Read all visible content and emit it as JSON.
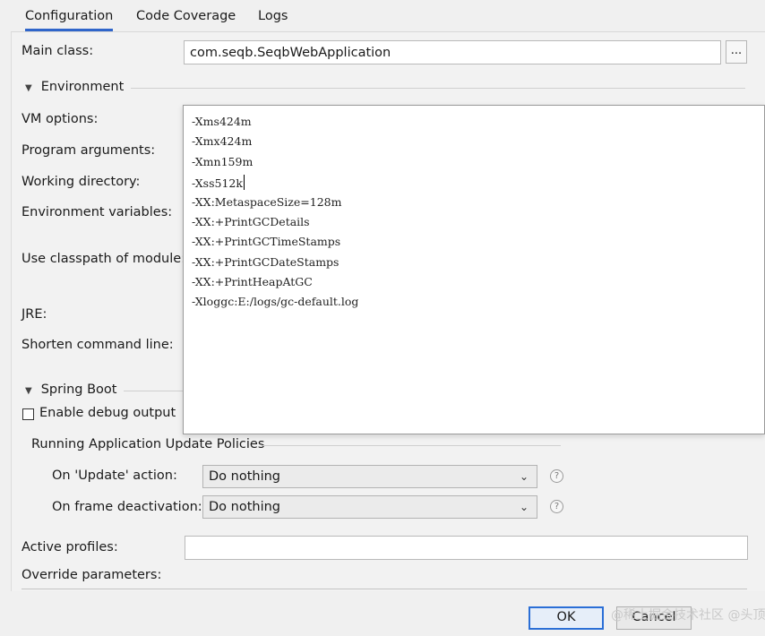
{
  "tabs": [
    {
      "label": "Configuration",
      "active": true
    },
    {
      "label": "Code Coverage",
      "active": false
    },
    {
      "label": "Logs",
      "active": false
    }
  ],
  "main_class": {
    "label": "Main class:",
    "value": "com.seqb.SeqbWebApplication",
    "browse": "..."
  },
  "environment": {
    "section_title": "Environment",
    "labels": {
      "vm_options": "VM options:",
      "program_arguments": "Program arguments:",
      "working_directory": "Working directory:",
      "environment_variables": "Environment variables:",
      "use_classpath": "Use classpath of module:",
      "jre": "JRE:",
      "shorten_command_line": "Shorten command line:"
    }
  },
  "vm_options_lines": [
    "-Xms424m",
    "-Xmx424m",
    "-Xmn159m",
    "-Xss512k",
    "-XX:MetaspaceSize=128m",
    "-XX:+PrintGCDetails",
    "-XX:+PrintGCTimeStamps",
    "-XX:+PrintGCDateStamps",
    "-XX:+PrintHeapAtGC",
    "-Xloggc:E:/logs/gc-default.log"
  ],
  "spring_boot": {
    "section_title": "Spring Boot",
    "enable_debug_output": {
      "label": "Enable debug output",
      "checked": false
    },
    "update_policies": {
      "title": "Running Application Update Policies",
      "on_update": {
        "label": "On 'Update' action:",
        "value": "Do nothing"
      },
      "on_frame_deactivation": {
        "label": "On frame deactivation:",
        "value": "Do nothing"
      },
      "help_symbol": "?"
    },
    "active_profiles": {
      "label": "Active profiles:",
      "value": ""
    },
    "override_parameters": {
      "label": "Override parameters:"
    }
  },
  "buttons": {
    "ok": "OK",
    "cancel": "Cancel"
  },
  "watermark": "@稀土掘金技术社区 @头顶微笑",
  "colors": {
    "accent": "#2f65ca",
    "default_button_border": "#2b6fd6"
  }
}
